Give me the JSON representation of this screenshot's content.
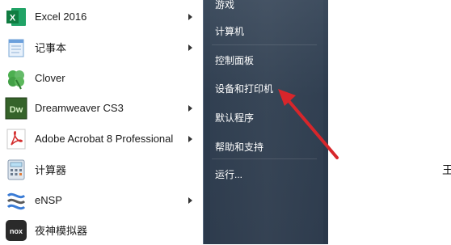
{
  "programs": [
    {
      "label": "Excel 2016",
      "icon": "excel-icon",
      "has_arrow": true
    },
    {
      "label": "记事本",
      "icon": "notepad-icon",
      "has_arrow": true
    },
    {
      "label": "Clover",
      "icon": "clover-icon",
      "has_arrow": false
    },
    {
      "label": "Dreamweaver CS3",
      "icon": "dreamweaver-icon",
      "has_arrow": true
    },
    {
      "label": "Adobe Acrobat 8 Professional",
      "icon": "acrobat-icon",
      "has_arrow": true
    },
    {
      "label": "计算器",
      "icon": "calculator-icon",
      "has_arrow": false
    },
    {
      "label": "eNSP",
      "icon": "ensp-icon",
      "has_arrow": true
    },
    {
      "label": "夜神模拟器",
      "icon": "nox-icon",
      "has_arrow": false
    }
  ],
  "right_panel": {
    "items": [
      "游戏",
      "计算机",
      "控制面板",
      "设备和打印机",
      "默认程序",
      "帮助和支持",
      "运行..."
    ]
  },
  "edge_text": "王",
  "annotation": {
    "color": "#d7262b"
  },
  "icon_text": {
    "excel": "X",
    "dreamweaver": "Dw",
    "nox": "nox"
  }
}
